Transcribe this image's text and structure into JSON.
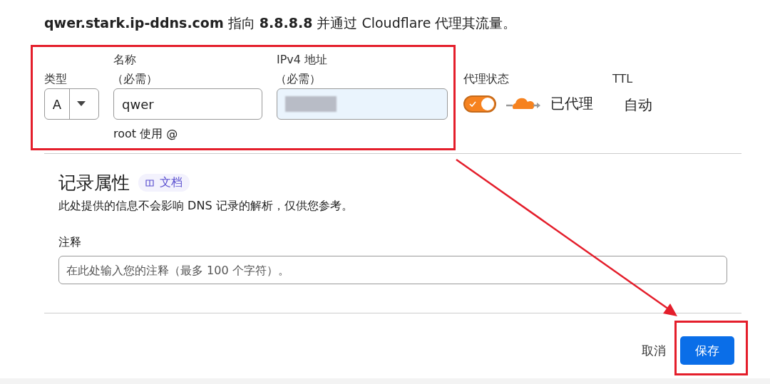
{
  "heading": "**qwer.stark.ip-ddns.com** 指向 **8.8.8.8** 并通过 Cloudflare 代理其流量。",
  "record": {
    "type": {
      "label": "类型",
      "value": "A"
    },
    "name": {
      "label": "名称",
      "required": "（必需）",
      "value": "qwer",
      "hint": "root 使用 @"
    },
    "ipv4": {
      "label": "IPv4 地址",
      "required": "（必需）"
    },
    "proxy": {
      "label": "代理状态",
      "on": true,
      "status": "已代理"
    },
    "ttl": {
      "label": "TTL",
      "value": "自动"
    }
  },
  "properties": {
    "title": "记录属性",
    "docs_link": "文档",
    "description": "此处提供的信息不会影响 DNS 记录的解析，仅供您参考。",
    "comment": {
      "label": "注释",
      "placeholder": "在此处输入您的注释（最多 100 个字符）。"
    }
  },
  "buttons": [
    {
      "label": "取消",
      "kind": "secondary"
    },
    {
      "label": "保存",
      "kind": "primary"
    }
  ]
}
